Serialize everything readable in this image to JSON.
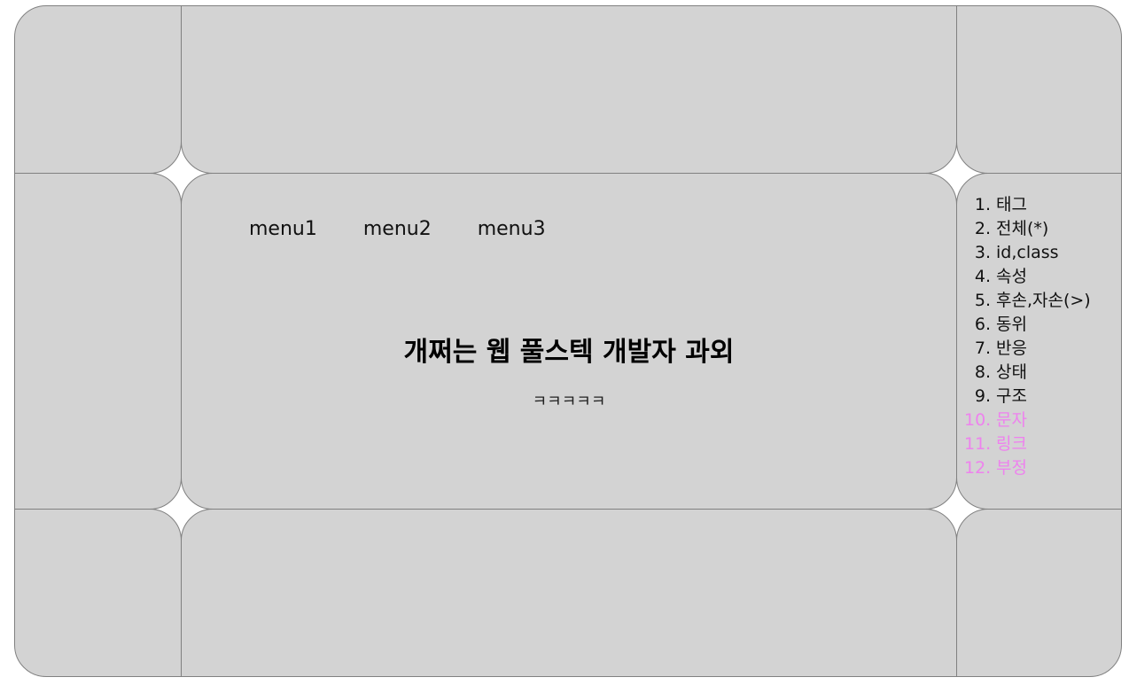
{
  "menu": {
    "items": [
      "menu1",
      "menu2",
      "menu3"
    ]
  },
  "main": {
    "headline": "개쩌는 웹 풀스텍 개발자 과외",
    "subline": "ㅋㅋㅋㅋㅋ"
  },
  "selectors": {
    "items": [
      {
        "num": "1.",
        "label": "태그"
      },
      {
        "num": "2.",
        "label": "전체(*)"
      },
      {
        "num": "3.",
        "label": "id,class"
      },
      {
        "num": "4.",
        "label": "속성"
      },
      {
        "num": "5.",
        "label": "후손,자손(>)"
      },
      {
        "num": "6.",
        "label": "동위"
      },
      {
        "num": "7.",
        "label": "반응"
      },
      {
        "num": "8.",
        "label": "상태"
      },
      {
        "num": "9.",
        "label": "구조"
      },
      {
        "num": "10.",
        "label": "문자"
      },
      {
        "num": "11.",
        "label": "링크"
      },
      {
        "num": "12.",
        "label": "부정"
      }
    ]
  },
  "colors": {
    "cell_bg": "#d3d3d3",
    "cell_border": "#808080",
    "highlight": "#ee82ee"
  }
}
